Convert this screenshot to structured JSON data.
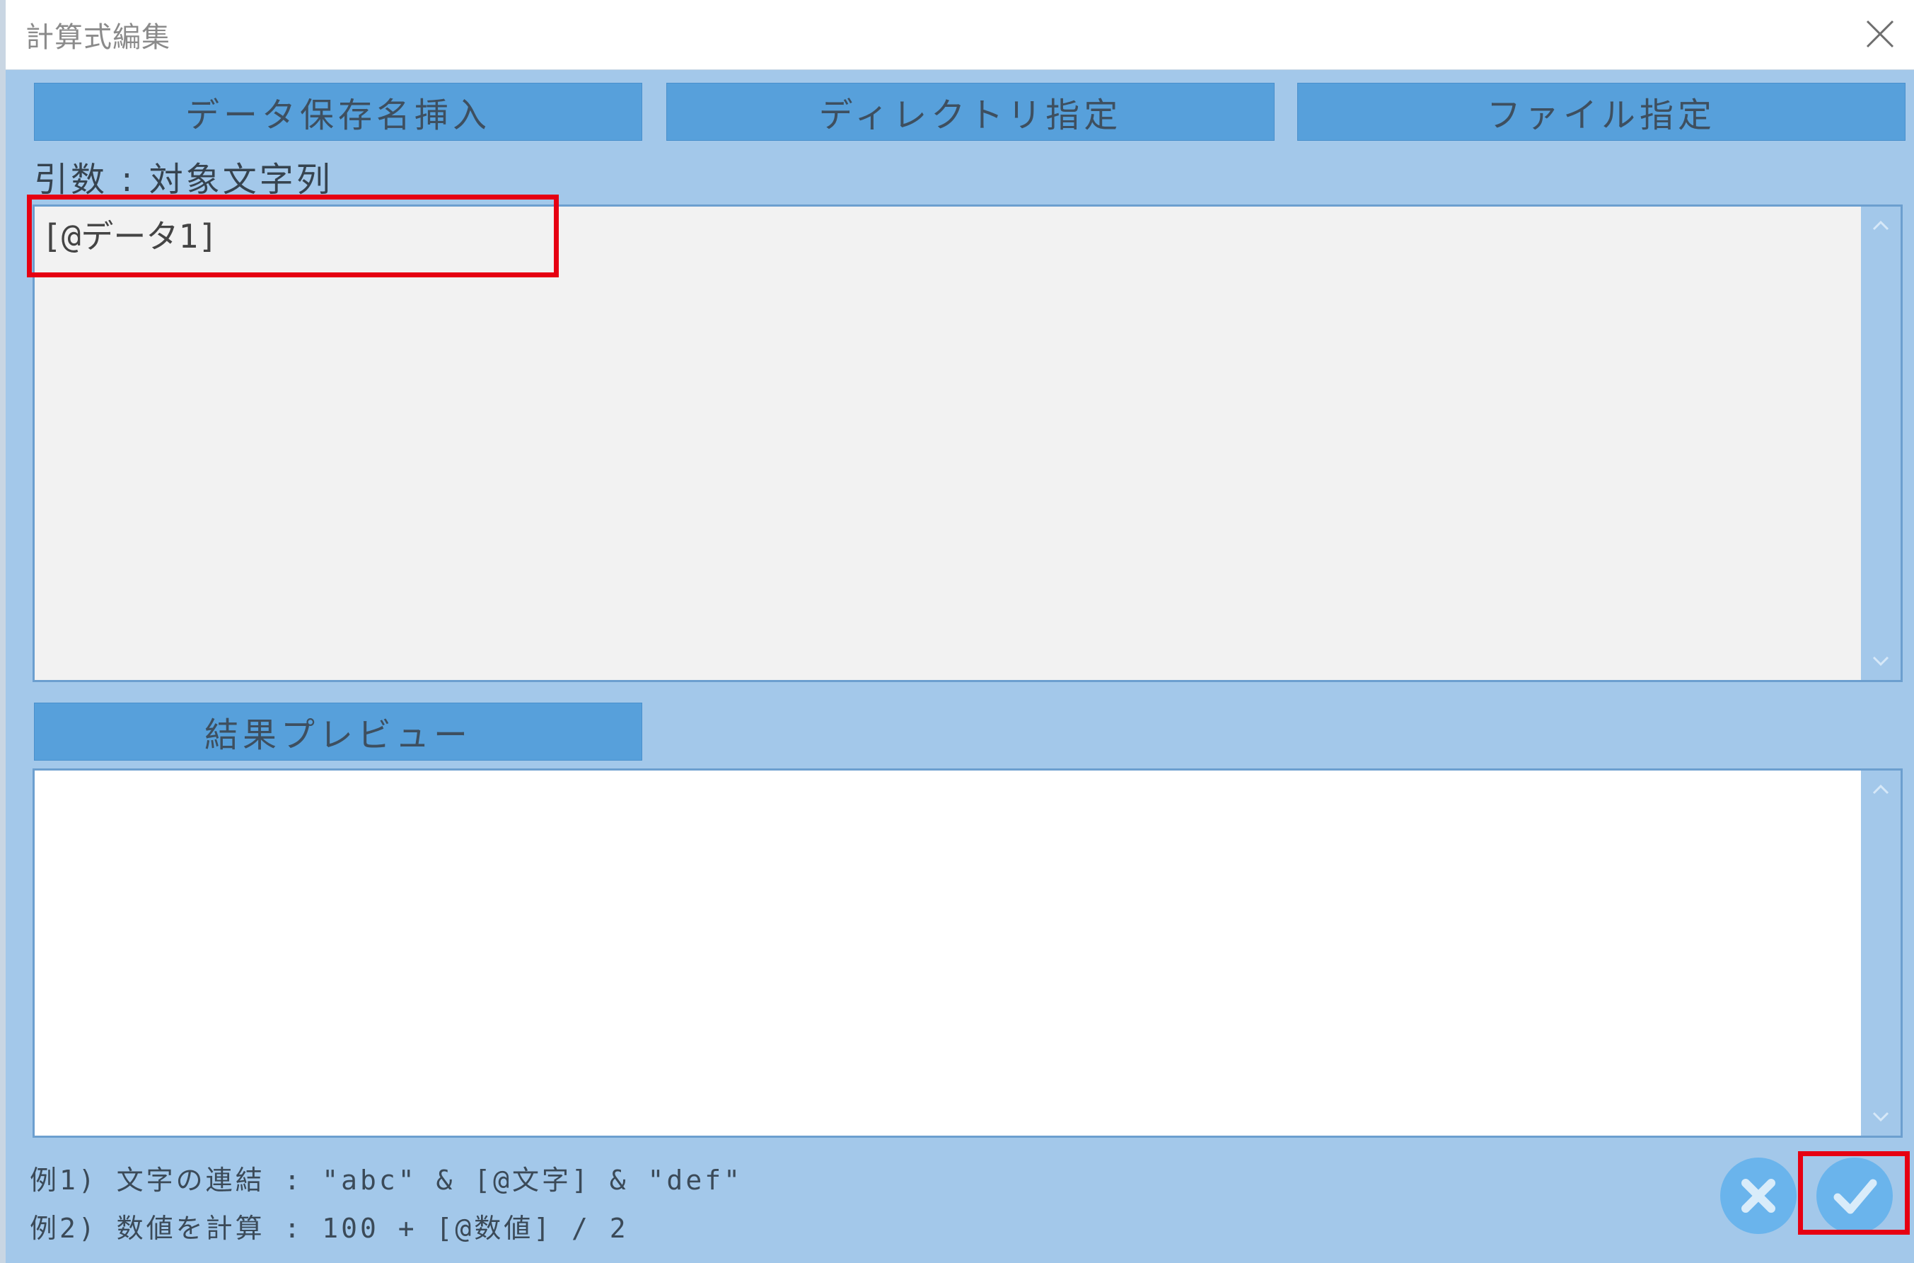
{
  "window": {
    "title": "計算式編集",
    "close_icon": "close-icon"
  },
  "toolbar": {
    "insert_data_name_label": "データ保存名挿入",
    "directory_label": "ディレクトリ指定",
    "file_label": "ファイル指定"
  },
  "argument": {
    "label": "引数 : 対象文字列",
    "value": "[@データ1]"
  },
  "preview": {
    "button_label": "結果プレビュー",
    "value": ""
  },
  "examples": {
    "line1": "例1) 文字の連結 : \"abc\" & [@文字] & \"def\"",
    "line2": "例2) 数値を計算 : 100 + [@数値] / 2"
  },
  "actions": {
    "cancel_icon": "x-icon",
    "ok_icon": "check-icon"
  },
  "colors": {
    "dialog_bg": "#a3c8ea",
    "button_bg": "#57a0db",
    "highlight": "#e60012"
  }
}
